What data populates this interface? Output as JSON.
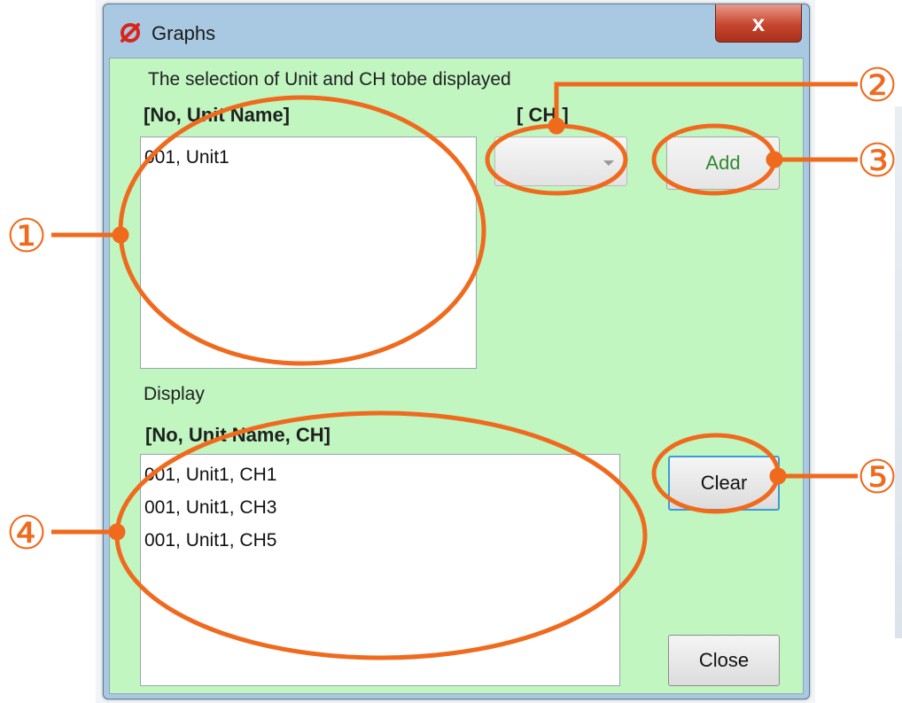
{
  "window": {
    "title": "Graphs",
    "close_glyph": "x"
  },
  "selection": {
    "heading": "The selection of Unit and CH tobe displayed",
    "unit_header": "[No, Unit Name]",
    "ch_header": "[ CH ]",
    "units": [
      "001, Unit1"
    ],
    "ch_value": "",
    "add_label": "Add"
  },
  "display": {
    "heading": "Display",
    "header": "[No, Unit Name, CH]",
    "items": [
      "001, Unit1, CH1",
      "001, Unit1, CH3",
      "001, Unit1, CH5"
    ],
    "clear_label": "Clear",
    "close_label": "Close"
  },
  "callouts": [
    "①",
    "②",
    "③",
    "④",
    "⑤"
  ],
  "colors": {
    "callout": "#f06a1e",
    "panel": "#c1f6c1",
    "add_text": "#2e8b2e",
    "clear_border": "#3c9bd6"
  }
}
